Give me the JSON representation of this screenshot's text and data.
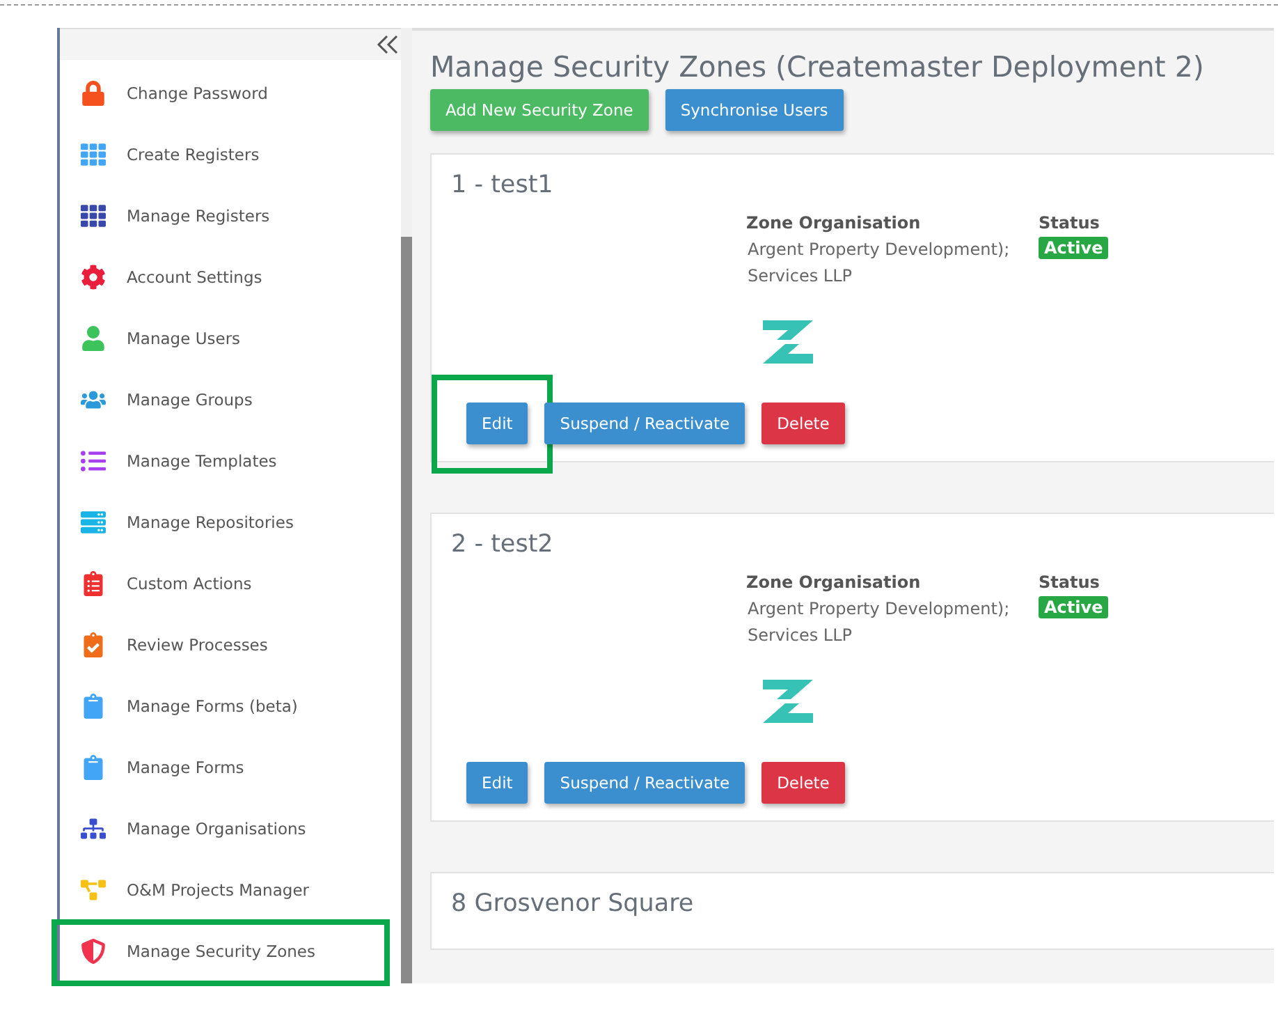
{
  "sidebar": {
    "items": [
      {
        "label": "Change Password",
        "highlighted": false
      },
      {
        "label": "Create Registers",
        "highlighted": false
      },
      {
        "label": "Manage Registers",
        "highlighted": false
      },
      {
        "label": "Account Settings",
        "highlighted": false
      },
      {
        "label": "Manage Users",
        "highlighted": false
      },
      {
        "label": "Manage Groups",
        "highlighted": false
      },
      {
        "label": "Manage Templates",
        "highlighted": false
      },
      {
        "label": "Manage Repositories",
        "highlighted": false
      },
      {
        "label": "Custom Actions",
        "highlighted": false
      },
      {
        "label": "Review Processes",
        "highlighted": false
      },
      {
        "label": "Manage Forms (beta)",
        "highlighted": false
      },
      {
        "label": "Manage Forms",
        "highlighted": false
      },
      {
        "label": "Manage Organisations",
        "highlighted": false
      },
      {
        "label": "O&M Projects Manager",
        "highlighted": false
      },
      {
        "label": "Manage Security Zones",
        "highlighted": true
      }
    ]
  },
  "page": {
    "title": "Manage Security Zones (Createmaster Deployment 2)",
    "actions": [
      {
        "label": "Add New Security Zone",
        "kind": "success"
      },
      {
        "label": "Synchronise Users",
        "kind": "primary"
      }
    ]
  },
  "zones": [
    {
      "title": "1 - test1",
      "org_heading": "Zone Organisation",
      "org_lines": [
        "Argent Property Development);",
        "Services LLP"
      ],
      "status_heading": "Status",
      "status": "Active",
      "buttons": [
        {
          "label": "Edit",
          "kind": "primary",
          "highlighted": true
        },
        {
          "label": "Suspend / Reactivate",
          "kind": "primary",
          "highlighted": false
        },
        {
          "label": "Delete",
          "kind": "danger",
          "highlighted": false
        }
      ]
    },
    {
      "title": "2 - test2",
      "org_heading": "Zone Organisation",
      "org_lines": [
        "Argent Property Development);",
        "Services LLP"
      ],
      "status_heading": "Status",
      "status": "Active",
      "buttons": [
        {
          "label": "Edit",
          "kind": "primary",
          "highlighted": false
        },
        {
          "label": "Suspend / Reactivate",
          "kind": "primary",
          "highlighted": false
        },
        {
          "label": "Delete",
          "kind": "danger",
          "highlighted": false
        }
      ]
    },
    {
      "title": "8 Grosvenor Square"
    }
  ]
}
